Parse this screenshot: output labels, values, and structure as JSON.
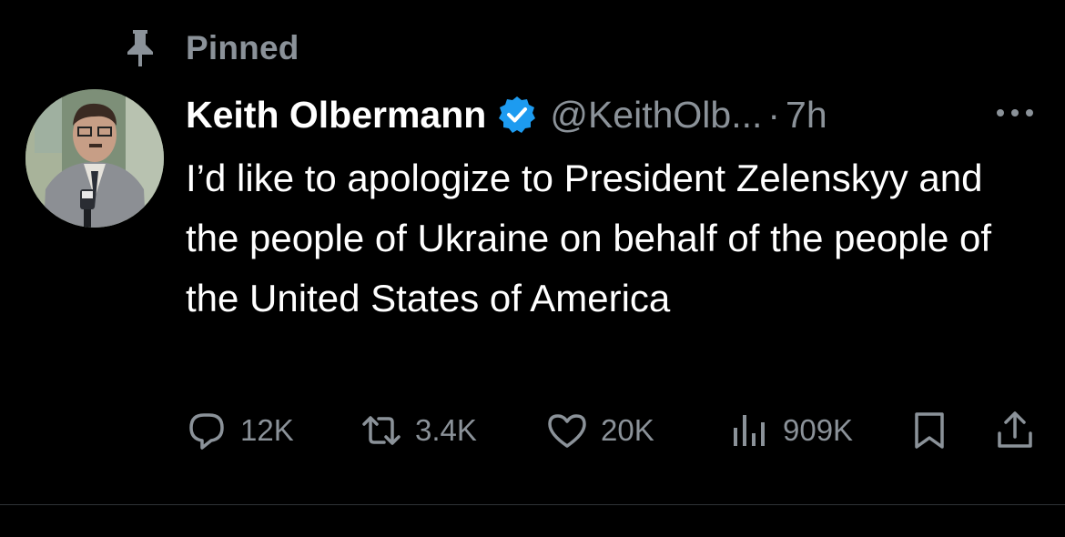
{
  "pinned": {
    "label": "Pinned",
    "icon": "pin-icon"
  },
  "author": {
    "display_name": "Keith Olbermann",
    "verified_icon": "verified-badge-icon",
    "handle": "@KeithOlb...",
    "separator": "·",
    "time": "7h"
  },
  "tweet": {
    "text": "I’d like to apologize to President Zelenskyy and the people of Ukraine on behalf of the people of the United States of America"
  },
  "actions": {
    "reply": {
      "icon": "reply-icon",
      "count": "12K"
    },
    "retweet": {
      "icon": "retweet-icon",
      "count": "3.4K"
    },
    "like": {
      "icon": "heart-icon",
      "count": "20K"
    },
    "views": {
      "icon": "views-chart-icon",
      "count": "909K"
    },
    "bookmark": {
      "icon": "bookmark-icon"
    },
    "share": {
      "icon": "share-icon"
    },
    "more": {
      "icon": "more-icon"
    }
  },
  "colors": {
    "background": "#000000",
    "text_primary": "#ffffff",
    "text_secondary": "#8b9299",
    "verified_blue": "#1d9bf0",
    "divider": "#2f3336"
  }
}
